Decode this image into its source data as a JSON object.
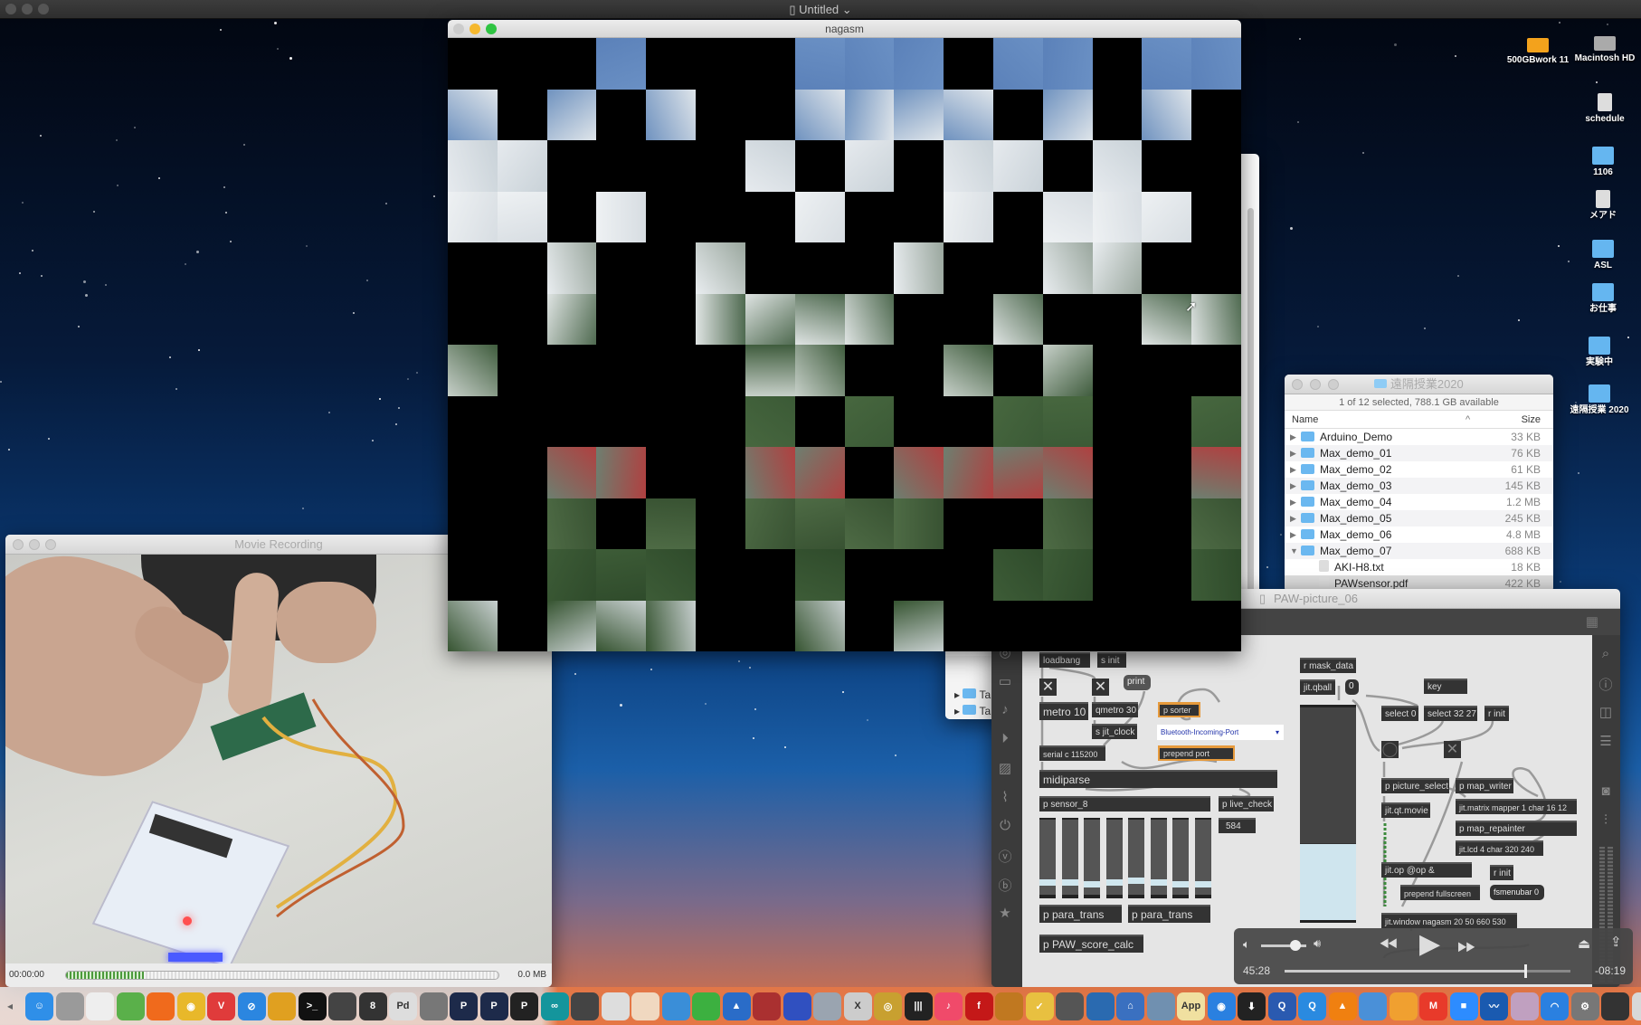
{
  "menubar": {
    "title": "Untitled",
    "chevron": "⌄"
  },
  "nagasm": {
    "title": "nagasm"
  },
  "finder": {
    "title": "遠隔授業2020",
    "status": "1 of 12 selected, 788.1 GB available",
    "col_name": "Name",
    "col_size": "Size",
    "rows": [
      {
        "name": "Arduino_Demo",
        "size": "33 KB",
        "type": "folder",
        "open": false
      },
      {
        "name": "Max_demo_01",
        "size": "76 KB",
        "type": "folder",
        "open": false
      },
      {
        "name": "Max_demo_02",
        "size": "61 KB",
        "type": "folder",
        "open": false
      },
      {
        "name": "Max_demo_03",
        "size": "145 KB",
        "type": "folder",
        "open": false
      },
      {
        "name": "Max_demo_04",
        "size": "1.2 MB",
        "type": "folder",
        "open": false
      },
      {
        "name": "Max_demo_05",
        "size": "245 KB",
        "type": "folder",
        "open": false
      },
      {
        "name": "Max_demo_06",
        "size": "4.8 MB",
        "type": "folder",
        "open": false
      },
      {
        "name": "Max_demo_07",
        "size": "688 KB",
        "type": "folder",
        "open": true
      },
      {
        "name": "AKI-H8.txt",
        "size": "18 KB",
        "type": "file"
      },
      {
        "name": "PAWsensor.pdf",
        "size": "422 KB",
        "type": "file"
      }
    ],
    "back_rows": [
      "Ta",
      "Ta"
    ]
  },
  "movie": {
    "title": "Movie Recording",
    "time": "00:00:00",
    "size": "0.0 MB",
    "level": 0.18
  },
  "patcher": {
    "title": "PAW-picture_06",
    "objects": {
      "loadbang": "loadbang",
      "s_init": "s init",
      "print": "print",
      "metro": "metro 10",
      "qmetro": "qmetro 30",
      "s_jit_clock": "s jit_clock",
      "p_sorter": "p sorter",
      "port_menu": "Bluetooth-Incoming-Port",
      "prepend_port": "prepend port",
      "serial": "serial c 115200",
      "midiparse": "midiparse",
      "p_sensor": "p sensor_8",
      "p_live_check": "p live_check",
      "number_584": "584",
      "para_trans_1": "p para_trans",
      "para_trans_2": "p para_trans",
      "paw_score": "p PAW_score_calc",
      "r_mask": "r mask_data",
      "jit_qball": "jit.qball",
      "number_0": "0",
      "key": "key",
      "select0": "select 0",
      "select3227": "select 32 27",
      "r_init_1": "r init",
      "picture_select": "p picture_select",
      "map_writer": "p map_writer",
      "matrix_mapper": "jit.matrix mapper 1 char 16 12",
      "qt_movie": "jit.qt.movie",
      "map_repainter": "p map_repainter",
      "jit_lcd": "jit.lcd 4 char 320 240",
      "jit_op": "jit.op @op &",
      "r_init_2": "r init",
      "prepend_fullscreen": "prepend fullscreen",
      "fsmenubar": "fsmenubar 0",
      "jit_window": "jit.window nagasm 20 50 660 530",
      "toggle_x": "✕",
      "button_o": "◯"
    },
    "slider_values": [
      0.12,
      0.12,
      0.1,
      0.12,
      0.14,
      0.12,
      0.1,
      0.1
    ]
  },
  "player": {
    "elapsed": "45:28",
    "remaining": "-08:19",
    "progress": 0.84,
    "volume": 0.75
  },
  "desktop": [
    {
      "label": "500GBwork 11",
      "kind": "drive"
    },
    {
      "label": "Macintosh HD",
      "kind": "drive"
    },
    {
      "label": "schedule",
      "kind": "doc"
    },
    {
      "label": "1106",
      "kind": "folder"
    },
    {
      "label": "メアド",
      "kind": "doc"
    },
    {
      "label": "ASL",
      "kind": "folder"
    },
    {
      "label": "お仕事",
      "kind": "folder"
    },
    {
      "label": "実験中",
      "kind": "folder"
    },
    {
      "label": "遠隔授業 2020",
      "kind": "folder"
    }
  ],
  "dock": [
    {
      "icon": "finder-icon",
      "color": "#2f8fe8",
      "glyph": "☺"
    },
    {
      "icon": "script-editor-icon",
      "color": "#9a9a9a",
      "glyph": ""
    },
    {
      "icon": "textedit-icon",
      "color": "#eeeeee",
      "glyph": ""
    },
    {
      "icon": "numbers-icon",
      "color": "#5ab04a",
      "glyph": ""
    },
    {
      "icon": "firefox-icon",
      "color": "#f06a1c",
      "glyph": ""
    },
    {
      "icon": "chrome-icon",
      "color": "#e8b82a",
      "glyph": "◉"
    },
    {
      "icon": "vivaldi-icon",
      "color": "#e03b3b",
      "glyph": "V"
    },
    {
      "icon": "safari-icon",
      "color": "#2b86e0",
      "glyph": "⊘"
    },
    {
      "icon": "app-icon",
      "color": "#e0a020",
      "glyph": ""
    },
    {
      "icon": "terminal-icon",
      "color": "#111111",
      "glyph": ">_"
    },
    {
      "icon": "app-icon",
      "color": "#444444",
      "glyph": ""
    },
    {
      "icon": "app-icon",
      "color": "#333333",
      "glyph": "8"
    },
    {
      "icon": "pd-icon",
      "color": "#dddddd",
      "glyph": "Pd"
    },
    {
      "icon": "app-icon",
      "color": "#777777",
      "glyph": ""
    },
    {
      "icon": "processing-icon",
      "color": "#1d2a4a",
      "glyph": "P"
    },
    {
      "icon": "processing-icon",
      "color": "#1d2a4a",
      "glyph": "P"
    },
    {
      "icon": "app-icon",
      "color": "#222222",
      "glyph": "P"
    },
    {
      "icon": "arduino-icon",
      "color": "#14959c",
      "glyph": "∞"
    },
    {
      "icon": "app-icon",
      "color": "#444444",
      "glyph": ""
    },
    {
      "icon": "app-icon",
      "color": "#dddddd",
      "glyph": ""
    },
    {
      "icon": "app-icon",
      "color": "#f0d8c0",
      "glyph": ""
    },
    {
      "icon": "xcode-icon",
      "color": "#3a8ed8",
      "glyph": ""
    },
    {
      "icon": "app-icon",
      "color": "#3cb040",
      "glyph": ""
    },
    {
      "icon": "app-icon",
      "color": "#2a6cc8",
      "glyph": "▲"
    },
    {
      "icon": "app-icon",
      "color": "#aa3030",
      "glyph": ""
    },
    {
      "icon": "app-icon",
      "color": "#3050c0",
      "glyph": ""
    },
    {
      "icon": "preview-icon",
      "color": "#9aa4b0",
      "glyph": ""
    },
    {
      "icon": "app-icon",
      "color": "#cccccc",
      "glyph": "X"
    },
    {
      "icon": "app-icon",
      "color": "#c8a030",
      "glyph": "◎"
    },
    {
      "icon": "piano-icon",
      "color": "#222222",
      "glyph": "|||"
    },
    {
      "icon": "itunes-icon",
      "color": "#f04a6a",
      "glyph": "♪"
    },
    {
      "icon": "flash-icon",
      "color": "#c41818",
      "glyph": "f"
    },
    {
      "icon": "guitar-icon",
      "color": "#c07820",
      "glyph": ""
    },
    {
      "icon": "app-icon",
      "color": "#e8c040",
      "glyph": "✓"
    },
    {
      "icon": "app-icon",
      "color": "#555555",
      "glyph": ""
    },
    {
      "icon": "app-icon",
      "color": "#2a6ab0",
      "glyph": ""
    },
    {
      "icon": "home-icon",
      "color": "#3a70c0",
      "glyph": "⌂"
    },
    {
      "icon": "app-icon",
      "color": "#7090b0",
      "glyph": ""
    },
    {
      "icon": "app-icon",
      "color": "#f0e0a0",
      "glyph": "App"
    },
    {
      "icon": "app-icon",
      "color": "#2a80e0",
      "glyph": "◉"
    },
    {
      "icon": "app-icon",
      "color": "#222222",
      "glyph": "⬇"
    },
    {
      "icon": "app-icon",
      "color": "#2a5ab0",
      "glyph": "Q"
    },
    {
      "icon": "quicktime-icon",
      "color": "#2a8ae0",
      "glyph": "Q"
    },
    {
      "icon": "vlc-icon",
      "color": "#f08010",
      "glyph": "▲"
    },
    {
      "icon": "keynote-icon",
      "color": "#4a90d8",
      "glyph": ""
    },
    {
      "icon": "pages-icon",
      "color": "#f0a030",
      "glyph": ""
    },
    {
      "icon": "gmail-icon",
      "color": "#e83a2a",
      "glyph": "M"
    },
    {
      "icon": "zoom-icon",
      "color": "#2d8cff",
      "glyph": "■"
    },
    {
      "icon": "activity-icon",
      "color": "#1a5ab0",
      "glyph": "〰"
    },
    {
      "icon": "app-icon",
      "color": "#c0a0c0",
      "glyph": ""
    },
    {
      "icon": "wifi-icon",
      "color": "#2a80e0",
      "glyph": "◠"
    },
    {
      "icon": "system-prefs-icon",
      "color": "#777777",
      "glyph": "⚙"
    },
    {
      "icon": "app-icon",
      "color": "#333333",
      "glyph": ""
    },
    {
      "icon": "trash-icon",
      "color": "#d8d8d8",
      "glyph": ""
    }
  ]
}
